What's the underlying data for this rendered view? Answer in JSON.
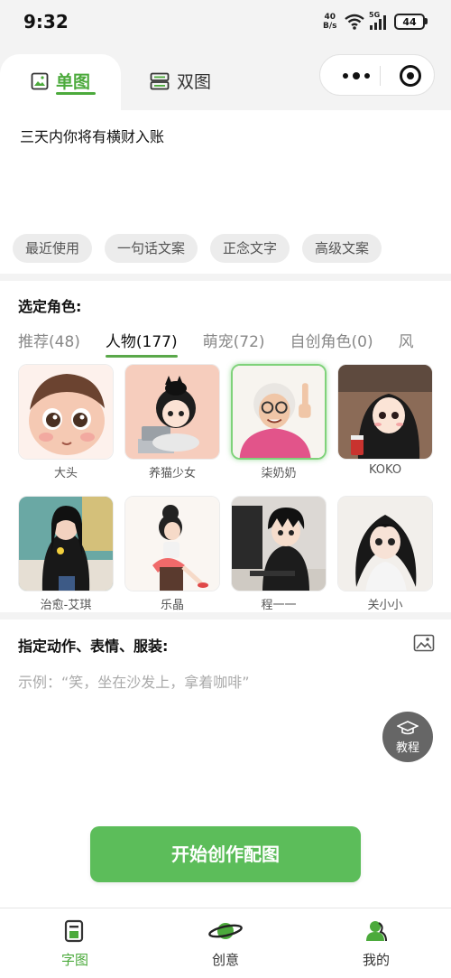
{
  "status_bar": {
    "time": "9:32",
    "net_speed_value": "40",
    "net_speed_unit": "B/s",
    "network": "5G",
    "battery": "44"
  },
  "tabs": {
    "single_label": "单图",
    "double_label": "双图"
  },
  "main_text": "三天内你将有横财入账",
  "chips": [
    "最近使用",
    "一句话文案",
    "正念文字",
    "高级文案"
  ],
  "role_section": {
    "title": "选定角色:",
    "tabs": [
      "推荐(48)",
      "人物(177)",
      "萌宠(72)",
      "自创角色(0)",
      "风"
    ],
    "active_tab_index": 1
  },
  "characters": [
    {
      "name": "大头",
      "bg": "#fdf1ec"
    },
    {
      "name": "养猫少女",
      "bg": "#f6cdbd"
    },
    {
      "name": "柒奶奶",
      "bg": "#f7f4ef"
    },
    {
      "name": "KOKO",
      "bg": "#8b6b57"
    },
    {
      "name": "治愈-艾琪",
      "bg": "#6aa8a4"
    },
    {
      "name": "乐晶",
      "bg": "#faf6f2"
    },
    {
      "name": "程一一",
      "bg": "#dcd8d4"
    },
    {
      "name": "关小小",
      "bg": "#f2efeb"
    }
  ],
  "action_section": {
    "title": "指定动作、表情、服装:",
    "placeholder": "示例：“笑，坐在沙发上，拿着咖啡”"
  },
  "tutorial_label": "教程",
  "create_button": "开始创作配图",
  "bottom_nav": [
    {
      "label": "字图",
      "icon": "text-image-icon",
      "active": true
    },
    {
      "label": "创意",
      "icon": "planet-icon",
      "active": false
    },
    {
      "label": "我的",
      "icon": "profile-icon",
      "active": false
    }
  ],
  "colors": {
    "accent": "#4caa3c",
    "button": "#5cbd5a",
    "chip_bg": "#ececec"
  }
}
